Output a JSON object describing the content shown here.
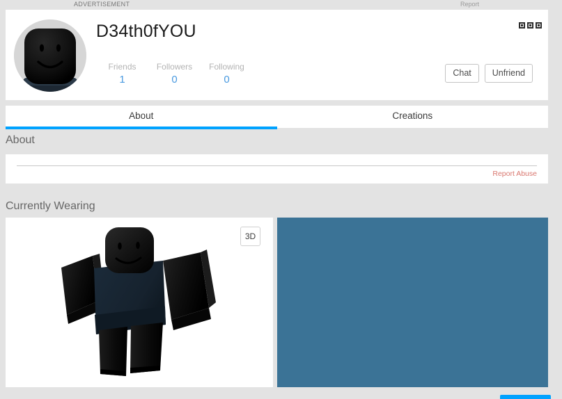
{
  "ad_bar": {
    "label": "ADVERTISEMENT",
    "report_label": "Report"
  },
  "profile": {
    "display_name": "D34th0fYOU",
    "avatar_icon": "roblox-headshot-avatar",
    "stats": [
      {
        "label": "Friends",
        "value": "1"
      },
      {
        "label": "Followers",
        "value": "0"
      },
      {
        "label": "Following",
        "value": "0"
      }
    ],
    "actions": [
      {
        "label": "Chat",
        "name": "chat-button"
      },
      {
        "label": "Unfriend",
        "name": "unfriend-button"
      }
    ],
    "more_menu_icon": "kebab-menu-icon"
  },
  "tabs": [
    {
      "label": "About",
      "active": true
    },
    {
      "label": "Creations",
      "active": false
    }
  ],
  "about": {
    "title": "About",
    "description": "",
    "report_abuse_label": "Report Abuse"
  },
  "currently_wearing": {
    "title": "Currently Wearing",
    "toggle_3d_label": "3D",
    "avatar_icon": "roblox-full-body-avatar"
  },
  "colors": {
    "page_background": "#e3e3e3",
    "card_background": "#ffffff",
    "accent_blue": "#00a2ff",
    "stat_value_blue": "#4a9ae0",
    "report_abuse_red": "#d9776f",
    "panel_steel_blue": "#3b7396",
    "avatar_head_black": "#0d0d0d",
    "avatar_torso_navy": "#16222e"
  }
}
